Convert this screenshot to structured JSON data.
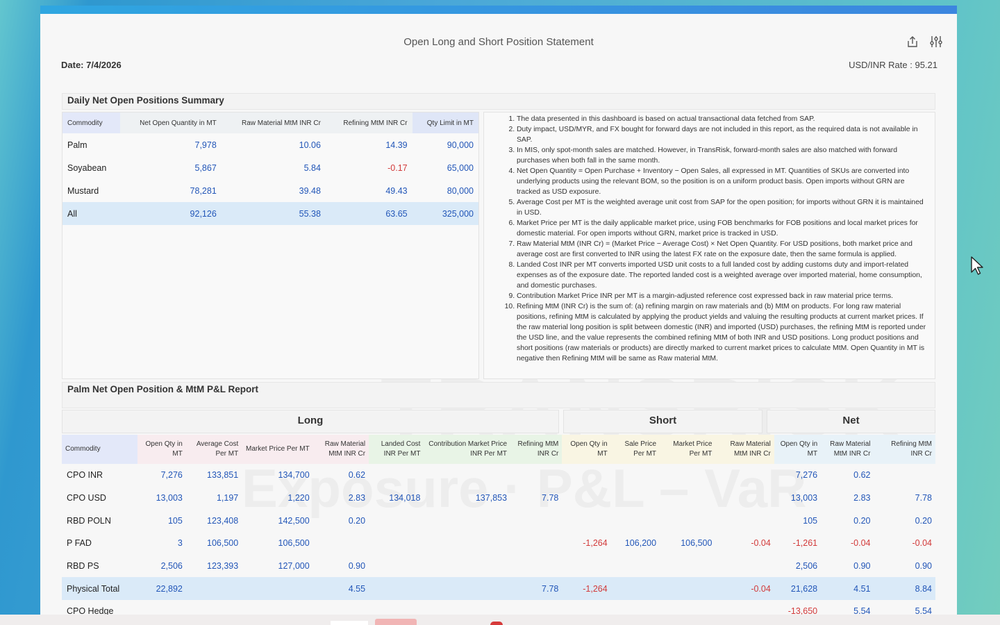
{
  "header": {
    "title": "Open Long and Short Position Statement",
    "date": "Date: 7/4/2026",
    "rate": "USD/INR Rate : 95.21",
    "icons": [
      "share-icon",
      "settings-sliders-icon"
    ]
  },
  "summary": {
    "title": "Daily Net Open Positions Summary",
    "columns": [
      "Commodity",
      "Net Open Quantity in MT",
      "Raw Material MtM INR Cr",
      "Refining MtM INR Cr",
      "Qty Limit in MT"
    ],
    "rows": [
      [
        "Palm",
        "7,978",
        "10.06",
        "14.39",
        "90,000"
      ],
      [
        "Soyabean",
        "5,867",
        "5.84",
        "-0.17",
        "65,000"
      ],
      [
        "Mustard",
        "78,281",
        "39.48",
        "49.43",
        "80,000"
      ]
    ],
    "total": [
      "All",
      "92,126",
      "55.38",
      "63.65",
      "325,000"
    ]
  },
  "notes": [
    "The data presented in this dashboard is based on actual transactional data fetched from SAP.",
    "Duty impact, USD/MYR, and FX bought for forward days are not included in this report, as the required data is not available in SAP.",
    "In MIS, only spot-month sales are matched. However, in TransRisk, forward-month sales are also matched with forward purchases when both fall in the same month.",
    "Net Open Quantity = Open Purchase + Inventory − Open Sales, all expressed in MT. Quantities of SKUs are converted into underlying products using the relevant BOM, so the position is on a uniform product basis. Open imports without GRN are tracked as USD exposure.",
    "Average Cost per MT is the weighted average unit cost from SAP for the open position; for imports without GRN it is maintained in USD.",
    "Market Price per MT is the daily applicable market price, using FOB benchmarks for FOB positions and local market prices for domestic material. For open imports without GRN, market price is tracked in USD.",
    "Raw Material MtM (INR Cr) = (Market Price − Average Cost) × Net Open Quantity. For USD positions, both market price and average cost are first converted to INR using the latest FX rate on the exposure date, then the same formula is applied.",
    "Landed Cost INR per MT converts imported USD unit costs to a full landed cost by adding customs duty and import-related expenses as of the exposure date. The reported landed cost is a weighted average over imported material, home consumption, and domestic purchases.",
    "Contribution Market Price INR per MT is a margin-adjusted reference cost expressed back in raw material price terms.",
    "Refining MtM (INR Cr) is the sum of: (a) refining margin on raw materials and (b) MtM on products. For long raw material positions, refining MtM is calculated by applying the product yields and valuing the resulting products at current market prices. If the raw material long position is split between domestic (INR) and imported (USD) purchases, the refining MtM is reported under the USD line, and the value represents the combined refining MtM of both INR and USD positions. Long product positions and short positions (raw materials or products) are directly marked to current market prices to calculate MtM. Open Quantity in MT is negative then Refining MtM will be same as Raw material MtM."
  ],
  "palm": {
    "title": "Palm Net Open Position & MtM P&L Report",
    "groups": [
      "Long",
      "Short",
      "Net"
    ],
    "columns": [
      "Commodity",
      "Open Qty in MT",
      "Average Cost Per MT",
      "Market Price Per MT",
      "Raw Material MtM INR Cr",
      "Landed Cost INR Per MT",
      "Contribution Market Price INR Per MT",
      "Refining MtM INR Cr",
      "Open Qty in MT",
      "Sale Price Per MT",
      "Market Price Per MT",
      "Raw Material MtM INR Cr",
      "Open Qty in MT",
      "Raw Material MtM INR Cr",
      "Refining MtM INR Cr"
    ],
    "rows": [
      [
        "CPO INR",
        "7,276",
        "133,851",
        "134,700",
        "0.62",
        "",
        "",
        "",
        "",
        "",
        "",
        "",
        "7,276",
        "0.62",
        ""
      ],
      [
        "CPO USD",
        "13,003",
        "1,197",
        "1,220",
        "2.83",
        "134,018",
        "137,853",
        "7.78",
        "",
        "",
        "",
        "",
        "13,003",
        "2.83",
        "7.78"
      ],
      [
        "RBD POLN",
        "105",
        "123,408",
        "142,500",
        "0.20",
        "",
        "",
        "",
        "",
        "",
        "",
        "",
        "105",
        "0.20",
        "0.20"
      ],
      [
        "P FAD",
        "3",
        "106,500",
        "106,500",
        "",
        "",
        "",
        "",
        "-1,264",
        "106,200",
        "106,500",
        "-0.04",
        "-1,261",
        "-0.04",
        "-0.04"
      ],
      [
        "RBD PS",
        "2,506",
        "123,393",
        "127,000",
        "0.90",
        "",
        "",
        "",
        "",
        "",
        "",
        "",
        "2,506",
        "0.90",
        "0.90"
      ],
      [
        "Physical Total",
        "22,892",
        "",
        "",
        "4.55",
        "",
        "",
        "7.78",
        "-1,264",
        "",
        "",
        "-0.04",
        "21,628",
        "4.51",
        "8.84"
      ],
      [
        "CPO Hedge",
        "",
        "",
        "",
        "",
        "",
        "",
        "",
        "",
        "",
        "",
        "",
        "-13,650",
        "5.54",
        "5.54"
      ]
    ],
    "total_row_index": 5
  },
  "watermark": {
    "brand": "TRANSRISK",
    "tagline": "Exposure · P&L – VaR"
  },
  "colors": {
    "positive": "#2256b8",
    "negative": "#d23a3a",
    "accent": "#2fa6e0"
  }
}
